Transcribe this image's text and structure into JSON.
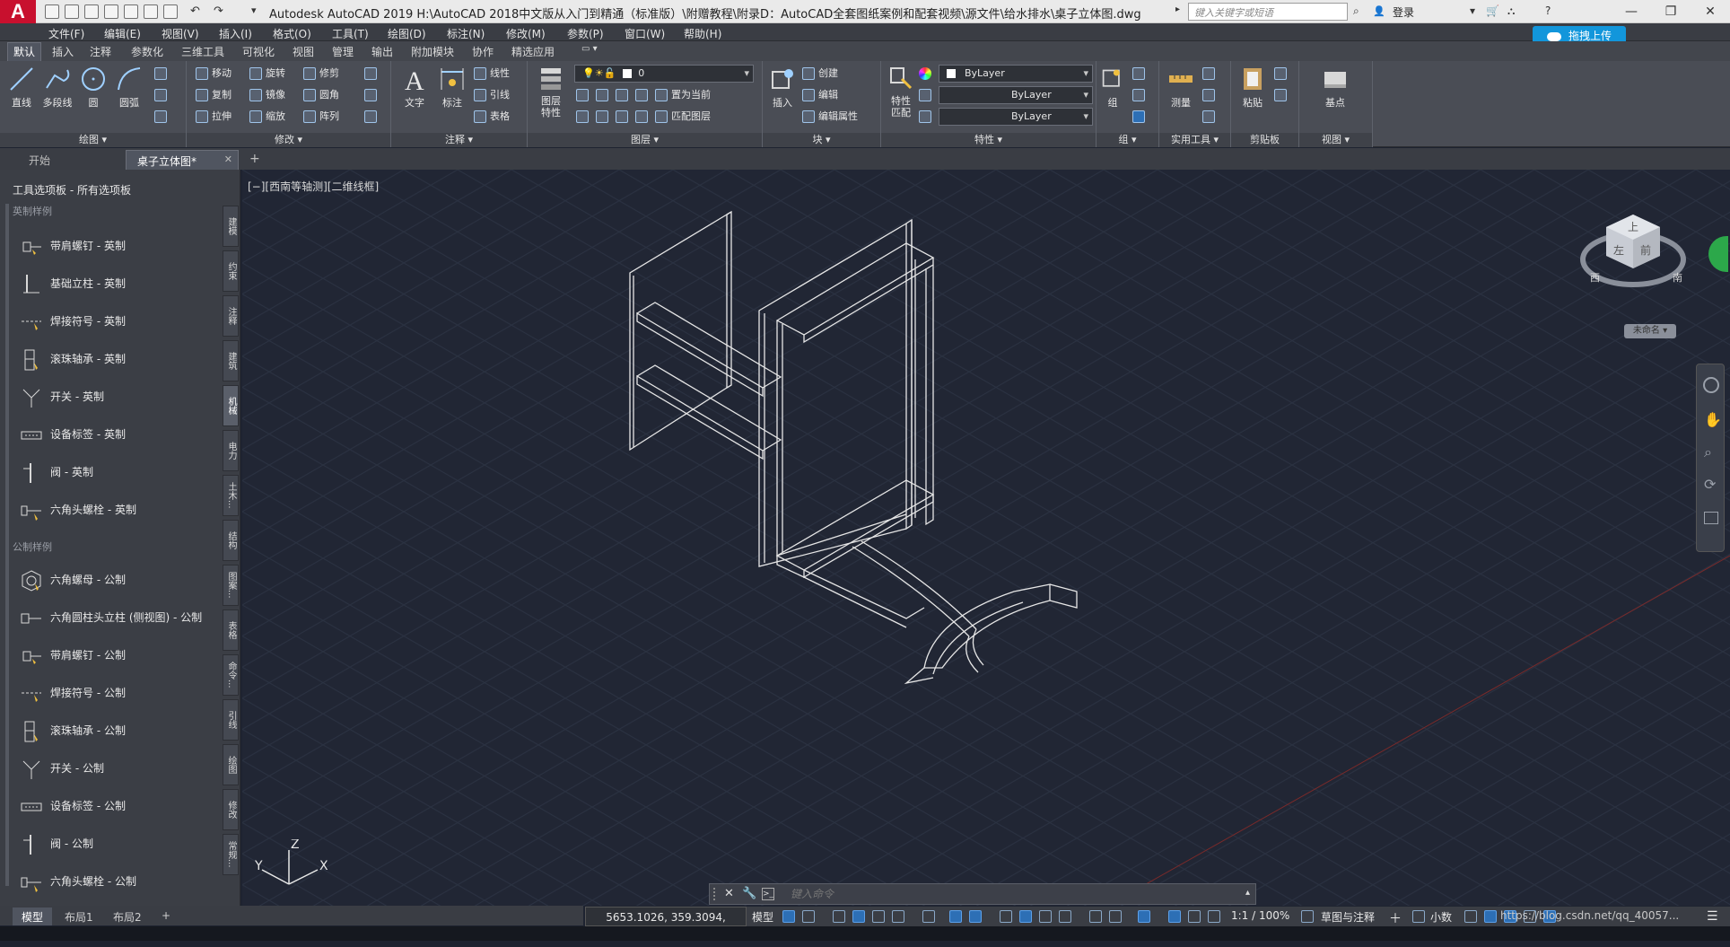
{
  "app": {
    "logo": "A",
    "title": "Autodesk AutoCAD 2019     H:\\AutoCAD 2018中文版从入门到精通（标准版）\\附赠教程\\附录D：AutoCAD全套图纸案例和配套视频\\源文件\\给水排水\\桌子立体图.dwg",
    "search_placeholder": "键入关键字或短语",
    "login": "登录",
    "upload": "拖拽上传"
  },
  "menu": [
    "文件(F)",
    "编辑(E)",
    "视图(V)",
    "插入(I)",
    "格式(O)",
    "工具(T)",
    "绘图(D)",
    "标注(N)",
    "修改(M)",
    "参数(P)",
    "窗口(W)",
    "帮助(H)"
  ],
  "ribbon_tabs": [
    "默认",
    "插入",
    "注释",
    "参数化",
    "三维工具",
    "可视化",
    "视图",
    "管理",
    "输出",
    "附加模块",
    "协作",
    "精选应用"
  ],
  "ribbon": {
    "draw": {
      "label": "绘图 ▾",
      "line": "直线",
      "polyline": "多段线",
      "circle": "圆",
      "arc": "圆弧"
    },
    "modify": {
      "label": "修改 ▾",
      "move": "移动",
      "rotate": "旋转",
      "trim": "修剪",
      "copy": "复制",
      "mirror": "镜像",
      "fillet": "圆角",
      "stretch": "拉伸",
      "scale": "缩放",
      "array": "阵列"
    },
    "annotation": {
      "label": "注释 ▾",
      "text": "文字",
      "dimension": "标注",
      "linear": "线性",
      "leader": "引线",
      "table": "表格"
    },
    "layers": {
      "label": "图层 ▾",
      "props": "图层\n特性",
      "current_layer": "0",
      "make_current": "置为当前",
      "match": "匹配图层"
    },
    "block": {
      "label": "块 ▾",
      "insert": "插入",
      "create": "创建",
      "edit": "编辑",
      "edit_attr": "编辑属性"
    },
    "properties": {
      "label": "特性 ▾",
      "match": "特性\n匹配",
      "color": "ByLayer",
      "linetype": "ByLayer",
      "lineweight": "ByLayer"
    },
    "groups": {
      "label": "组 ▾",
      "group": "组"
    },
    "utilities": {
      "label": "实用工具 ▾",
      "measure": "测量"
    },
    "clipboard": {
      "label": "剪贴板",
      "paste": "粘贴"
    },
    "view": {
      "label": "视图 ▾",
      "base": "基点"
    }
  },
  "file_tabs": [
    "开始",
    "桌子立体图*"
  ],
  "palette": {
    "title": "工具选项板 - 所有选项板",
    "section_imperial": "英制样例",
    "imperial_items": [
      "带肩螺钉 - 英制",
      "基础立柱 - 英制",
      "焊接符号 - 英制",
      "滚珠轴承 - 英制",
      "开关 - 英制",
      "设备标签 - 英制",
      "阀 - 英制",
      "六角头螺栓 - 英制"
    ],
    "section_metric": "公制样例",
    "metric_items": [
      "六角螺母 - 公制",
      "六角圆柱头立柱 (侧视图) - 公制",
      "带肩螺钉 - 公制",
      "焊接符号 - 公制",
      "滚珠轴承 - 公制",
      "开关 - 公制",
      "设备标签 - 公制",
      "阀 - 公制",
      "六角头螺栓 - 公制"
    ],
    "vertical_tabs": [
      "建模",
      "约束",
      "注释",
      "建筑",
      "机械",
      "电力",
      "土木...",
      "结构",
      "图案...",
      "表格",
      "命令...",
      "引线",
      "绘图",
      "修改",
      "常规..."
    ]
  },
  "viewport_label": "[−][西南等轴测][二维线框]",
  "viewcube": {
    "top": "上",
    "front": "前",
    "left": "左",
    "west": "西",
    "south": "南",
    "ucs": "未命名"
  },
  "ucs_labels": {
    "x": "X",
    "y": "Y",
    "z": "Z"
  },
  "layout_tabs": [
    "模型",
    "布局1",
    "布局2",
    "+"
  ],
  "status": {
    "coords": "5653.1026, 359.3094, 0.0000",
    "model": "模型",
    "scale": "1:1 / 100%",
    "workspace": "草图与注释",
    "units": "小数",
    "watermark": "https://blog.csdn.net/qq_40057..."
  },
  "command": {
    "placeholder": "键入命令"
  },
  "colors": {
    "accent": "#1296db",
    "canvas": "#212634",
    "grid": "#2b3242",
    "lines": "#e6e6e6"
  }
}
